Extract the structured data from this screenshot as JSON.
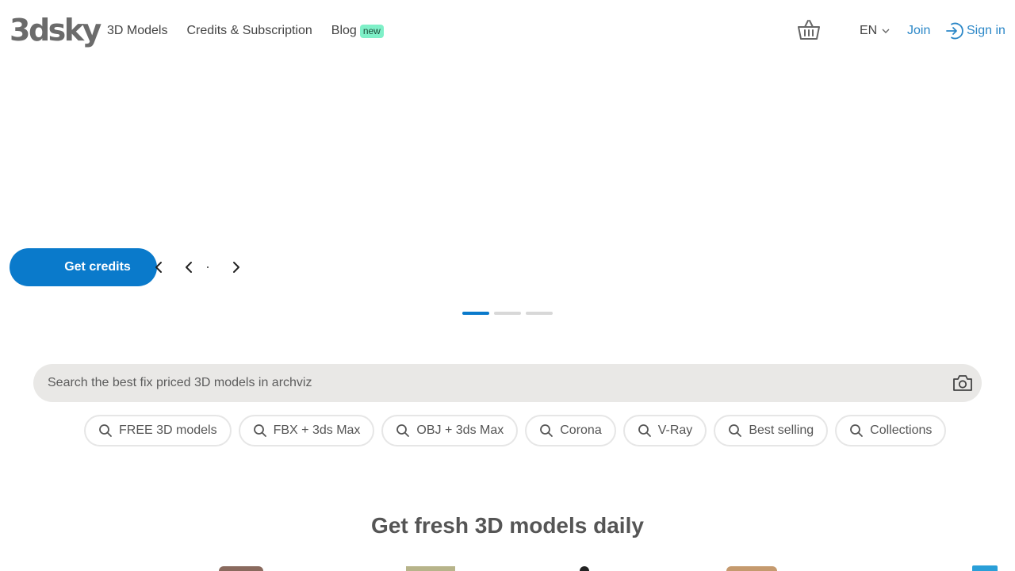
{
  "header": {
    "logo": "3dsky",
    "nav": [
      {
        "label": "3D Models"
      },
      {
        "label": "Credits & Subscription"
      },
      {
        "label": "Blog",
        "badge": "new"
      }
    ],
    "lang": "EN",
    "join": "Join",
    "sign_in": "Sign in"
  },
  "hero": {
    "cta_label": "Get credits",
    "slides": 3,
    "active_slide": 1
  },
  "search": {
    "placeholder": "Search the best fix priced 3D models in archviz"
  },
  "chips": [
    {
      "label": "FREE 3D models"
    },
    {
      "label": "FBX + 3ds Max"
    },
    {
      "label": "OBJ + 3ds Max"
    },
    {
      "label": "Corona"
    },
    {
      "label": "V-Ray"
    },
    {
      "label": "Best selling"
    },
    {
      "label": "Collections"
    }
  ],
  "section": {
    "title": "Get fresh 3D models daily"
  },
  "colors": {
    "accent": "#0a7acb",
    "link": "#2b87c7",
    "badge": "#7ff0c8",
    "search_bg": "#e9e8e6"
  }
}
